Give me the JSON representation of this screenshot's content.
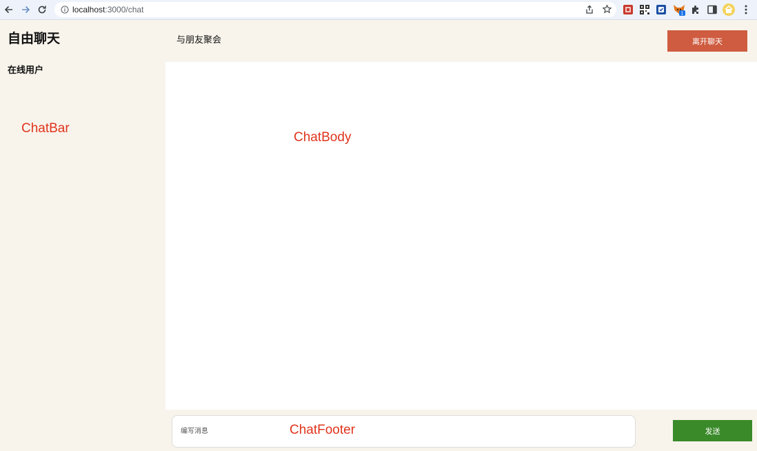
{
  "browser": {
    "url_host": "localhost",
    "url_path": ":3000/chat",
    "extension_badge": "1",
    "icons": {
      "back": "arrow-left-icon",
      "forward": "arrow-right-icon",
      "reload": "reload-icon",
      "info": "info-circle-icon",
      "share": "share-icon",
      "bookmark": "star-icon",
      "extensions": "puzzle-icon",
      "side_panel": "side-panel-icon",
      "menu": "kebab-menu-icon"
    }
  },
  "sidebar": {
    "title": "自由聊天",
    "users_heading": "在线用户",
    "annotation": "ChatBar"
  },
  "header": {
    "subtitle": "与朋友聚会",
    "leave_label": "离开聊天"
  },
  "body": {
    "annotation": "ChatBody"
  },
  "footer": {
    "input_placeholder": "编写消息",
    "input_value": "",
    "annotation": "ChatFooter",
    "send_label": "发送"
  },
  "colors": {
    "background": "#f8f4ec",
    "body_background": "#ffffff",
    "leave_button": "#cf5c40",
    "send_button": "#3a8a2a",
    "annotation": "#e0341c"
  }
}
